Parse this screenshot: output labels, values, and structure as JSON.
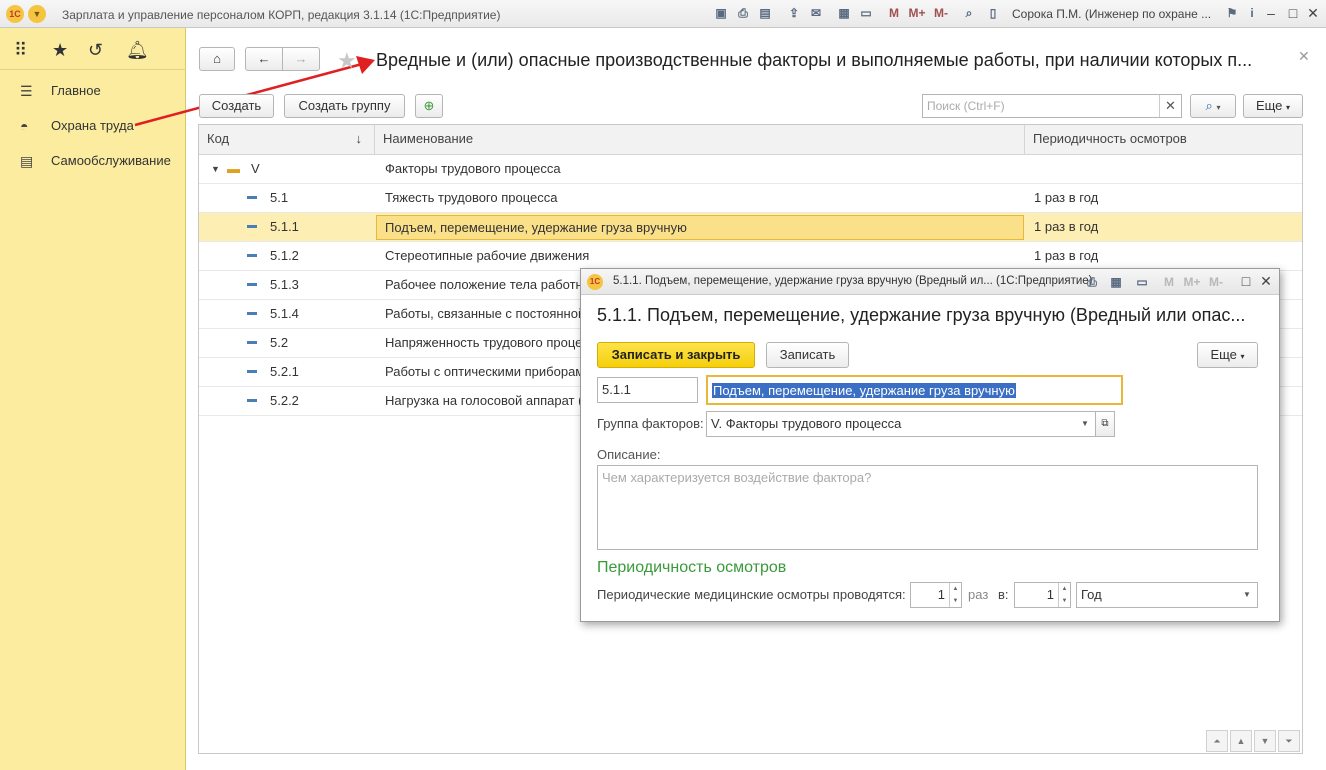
{
  "app": {
    "title": "Зарплата и управление персоналом КОРП, редакция 3.1.14 (1С:Предприятие)",
    "user": "Сорока П.М. (Инженер по охране ...",
    "logo": "1С",
    "toolbar_letters": [
      "M",
      "M+",
      "M-"
    ]
  },
  "sidebar": {
    "items": [
      {
        "label": "Главное",
        "icon": "menu-lines-icon"
      },
      {
        "label": "Охрана труда",
        "icon": "helmet-icon"
      },
      {
        "label": "Самообслуживание",
        "icon": "id-card-icon"
      }
    ]
  },
  "page": {
    "title": "Вредные и (или) опасные производственные факторы и выполняемые работы, при наличии которых п...",
    "create_label": "Создать",
    "create_group_label": "Создать группу",
    "search_placeholder": "Поиск (Ctrl+F)",
    "more_label": "Еще",
    "more_caret": "▾"
  },
  "table": {
    "columns": {
      "code": "Код",
      "name": "Наименование",
      "period": "Периодичность осмотров",
      "sort_arrow": "↓"
    },
    "rows": [
      {
        "code": "V",
        "name": "Факторы трудового процесса",
        "period": ""
      },
      {
        "code": "5.1",
        "name": "Тяжесть трудового процесса",
        "period": "1 раз в год"
      },
      {
        "code": "5.1.1",
        "name": "Подъем, перемещение, удержание груза вручную",
        "period": "1 раз в год"
      },
      {
        "code": "5.1.2",
        "name": "Стереотипные рабочие движения",
        "period": "1 раз в год"
      },
      {
        "code": "5.1.3",
        "name": "Рабочее положение тела работн",
        "period": ""
      },
      {
        "code": "5.1.4",
        "name": "Работы, связанные с постоянной",
        "period": ""
      },
      {
        "code": "5.2",
        "name": "Напряженность трудового проце",
        "period": ""
      },
      {
        "code": "5.2.1",
        "name": "Работы с оптическими приборам",
        "period": ""
      },
      {
        "code": "5.2.2",
        "name": "Нагрузка на голосовой аппарат (",
        "period": ""
      }
    ]
  },
  "dialog": {
    "window_title": "5.1.1. Подъем, перемещение, удержание груза вручную (Вредный ил... (1С:Предприятие)",
    "heading": "5.1.1. Подъем, перемещение, удержание груза вручную (Вредный или опас...",
    "save_close_label": "Записать и закрыть",
    "save_label": "Записать",
    "more_label": "Еще",
    "code_value": "5.1.1",
    "name_value": "Подъем, перемещение, удержание груза вручную",
    "group_label": "Группа факторов:",
    "group_value": "V. Факторы трудового процесса",
    "description_label": "Описание:",
    "description_placeholder": "Чем характеризуется воздействие фактора?",
    "section_title": "Периодичность осмотров",
    "periodic_label": "Периодические медицинские осмотры проводятся:",
    "times_value": "1",
    "times_label": "раз",
    "in_label": "в:",
    "period_count": "1",
    "period_unit": "Год"
  },
  "colors": {
    "sidebar_bg": "#fbeca0",
    "accent_yellow": "#f5d40a",
    "selected_row": "#fdefb4",
    "section_green": "#3a9a3a",
    "arrow_red": "#e02020"
  }
}
